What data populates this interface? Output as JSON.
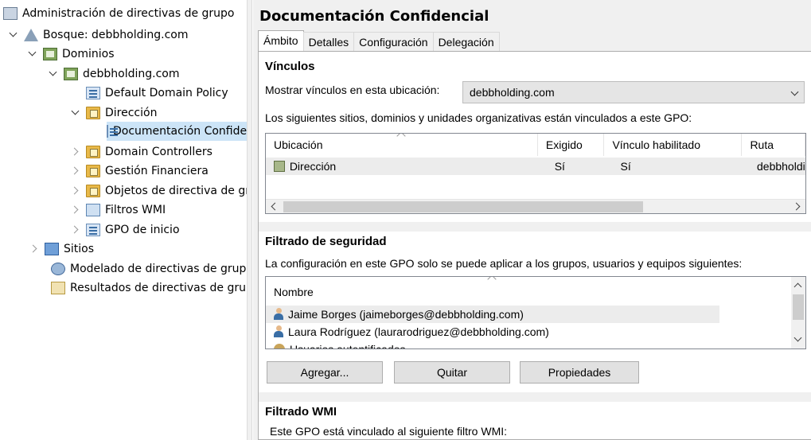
{
  "tree": {
    "root": "Administración de directivas de grupo",
    "forest": "Bosque: debbholding.com",
    "domains": "Dominios",
    "domain": "debbholding.com",
    "default_policy": "Default Domain Policy",
    "ou_direccion": "Dirección",
    "selected_gpo": "Documentación Confidencial",
    "domain_controllers": "Domain Controllers",
    "gestion_financiera": "Gestión Financiera",
    "gpo_objects": "Objetos de directiva de grupo",
    "wmi_filters": "Filtros WMI",
    "starter_gpos": "GPO de inicio",
    "sites": "Sitios",
    "modeling": "Modelado de directivas de grupo",
    "results": "Resultados de directivas de grupo"
  },
  "panel": {
    "title": "Documentación Confidencial",
    "tabs": [
      "Ámbito",
      "Detalles",
      "Configuración",
      "Delegación"
    ],
    "active_tab": "Ámbito"
  },
  "links": {
    "section_title": "Vínculos",
    "show_label": "Mostrar vínculos en esta ubicación:",
    "location_value": "debbholding.com",
    "description": "Los siguientes sitios, dominios y unidades organizativas están vinculados a este GPO:",
    "columns": [
      "Ubicación",
      "Exigido",
      "Vínculo habilitado",
      "Ruta"
    ],
    "rows": [
      {
        "location": "Dirección",
        "enforced": "Sí",
        "enabled": "Sí",
        "path": "debbholding.com/Dirección"
      }
    ]
  },
  "security": {
    "section_title": "Filtrado de seguridad",
    "description": "La configuración en este GPO solo se puede aplicar a los grupos, usuarios y equipos siguientes:",
    "column": "Nombre",
    "items": [
      "Jaime Borges (jaimeborges@debbholding.com)",
      "Laura Rodríguez (laurarodriguez@debbholding.com)",
      "Usuarios autentificados"
    ],
    "buttons": {
      "add": "Agregar...",
      "remove": "Quitar",
      "properties": "Propiedades"
    }
  },
  "wmi": {
    "section_title": "Filtrado WMI",
    "description": "Este GPO está vinculado al siguiente filtro WMI:"
  }
}
